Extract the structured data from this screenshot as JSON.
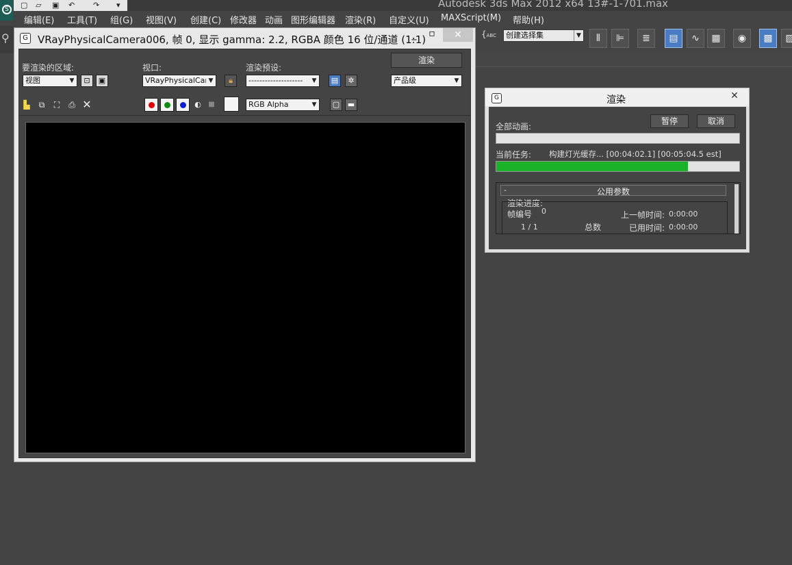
{
  "app": {
    "title": "Autodesk 3ds Max  2012 x64      13#-1-701.max",
    "menu": [
      "编辑(E)",
      "工具(T)",
      "组(G)",
      "视图(V)",
      "创建(C)",
      "修改器",
      "动画",
      "图形编辑器",
      "渲染(R)",
      "自定义(U)",
      "MAXScript(M)",
      "帮助(H)"
    ],
    "selection_set": "创建选择集",
    "abc_label": "ABC"
  },
  "vfb": {
    "title": "VRayPhysicalCamera006, 帧 0, 显示 gamma: 2.2, RGBA 颜色 16 位/通道 (1:1)",
    "area_label": "要渲染的区域:",
    "area_value": "视图",
    "viewport_label": "视口:",
    "viewport_value": "VRayPhysicalCam",
    "preset_label": "渲染预设:",
    "preset_value": "--------------------",
    "render_button": "渲染",
    "quality_value": "产品级",
    "channel_value": "RGB Alpha"
  },
  "render_dialog": {
    "title": "渲染",
    "pause_button": "暂停",
    "cancel_button": "取消",
    "all_animation_label": "全部动画:",
    "all_animation_progress": 0,
    "current_task_label": "当前任务:",
    "current_task_text": "构建灯光缓存... [00:04:02.1] [00:05:04.5 est]",
    "current_task_progress": 0.79,
    "rollout_title": "公用参数",
    "rollout_minus": "-",
    "group_label": "渲染进度:",
    "frame_no_label": "帧编号",
    "frame_no_value": "0",
    "last_frame_time_label": "上一帧时间:",
    "last_frame_time_value": "0:00:00",
    "frame_count": "1  /  1",
    "total_label": "总数",
    "elapsed_label": "已用时间:",
    "elapsed_value": "0:00:00"
  },
  "colors": {
    "background": "#444444",
    "progress_fill": "#19b228",
    "highlight": "#4a7cc4"
  }
}
